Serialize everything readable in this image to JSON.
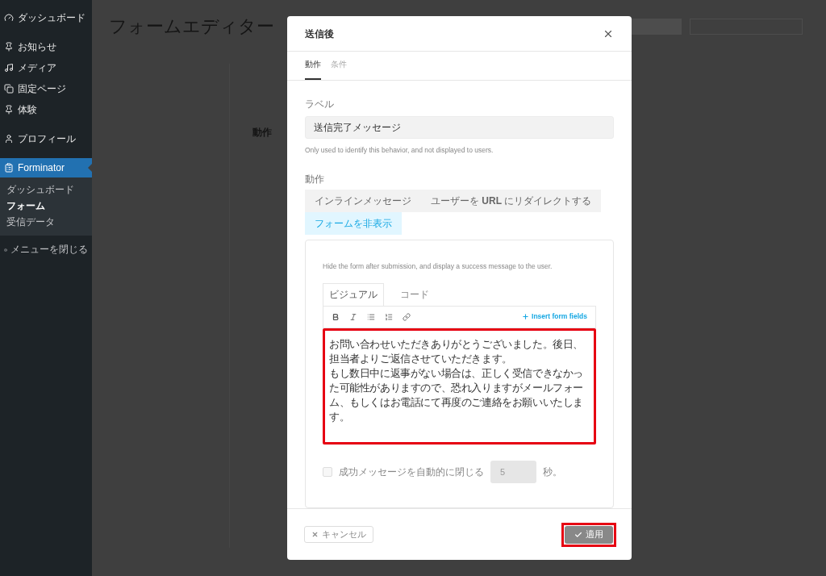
{
  "sidebar": {
    "items": [
      {
        "label": "ダッシュボード",
        "selected": false
      },
      {
        "label": "お知らせ",
        "selected": false
      },
      {
        "label": "メディア",
        "selected": false
      },
      {
        "label": "固定ページ",
        "selected": false
      },
      {
        "label": "体験",
        "selected": false
      },
      {
        "label": "プロフィール",
        "selected": false
      },
      {
        "label": "Forminator",
        "selected": true,
        "children": [
          {
            "label": "ダッシュボード",
            "selected": false
          },
          {
            "label": "フォーム",
            "selected": true
          },
          {
            "label": "受信データ",
            "selected": false
          }
        ]
      }
    ],
    "collapse": "メニューを閉じる"
  },
  "page": {
    "title": "フォームエディター",
    "section_heading": "動作"
  },
  "modal": {
    "title": "送信後",
    "tabs": [
      {
        "label": "動作",
        "selected": true
      },
      {
        "label": "条件",
        "selected": false
      }
    ],
    "label_field": {
      "label": "ラベル",
      "value": "送信完了メッセージ",
      "help": "Only used to identify this behavior, and not displayed to users."
    },
    "behavior": {
      "label": "動作",
      "options": [
        {
          "label": "インラインメッセージ",
          "selected": false
        },
        {
          "label": "ユーザーを **URL** にリダイレクトする",
          "selected": false
        },
        {
          "label": "フォームを非表示",
          "selected": true
        }
      ]
    },
    "panel": {
      "description": "Hide the form after submission, and display a success message to the user.",
      "editor_tabs": [
        {
          "label": "ビジュアル",
          "selected": true
        },
        {
          "label": "コード",
          "selected": false
        }
      ],
      "insert_fields": "Insert form fields",
      "content": [
        "お問い合わせいただきありがとうございました。後日、担当者よりご返信させていただきます。",
        "もし数日中に返事がない場合は、正しく受信できなかった可能性がありますので、恐れ入りますがメールフォーム、もしくはお電話にて再度のご連絡をお願いいたします。"
      ],
      "auto_close": {
        "checked": false,
        "label": "成功メッセージを自動的に閉じる",
        "value": "5",
        "unit": "秒。"
      }
    },
    "footer": {
      "cancel": "キャンセル",
      "apply": "適用"
    }
  }
}
